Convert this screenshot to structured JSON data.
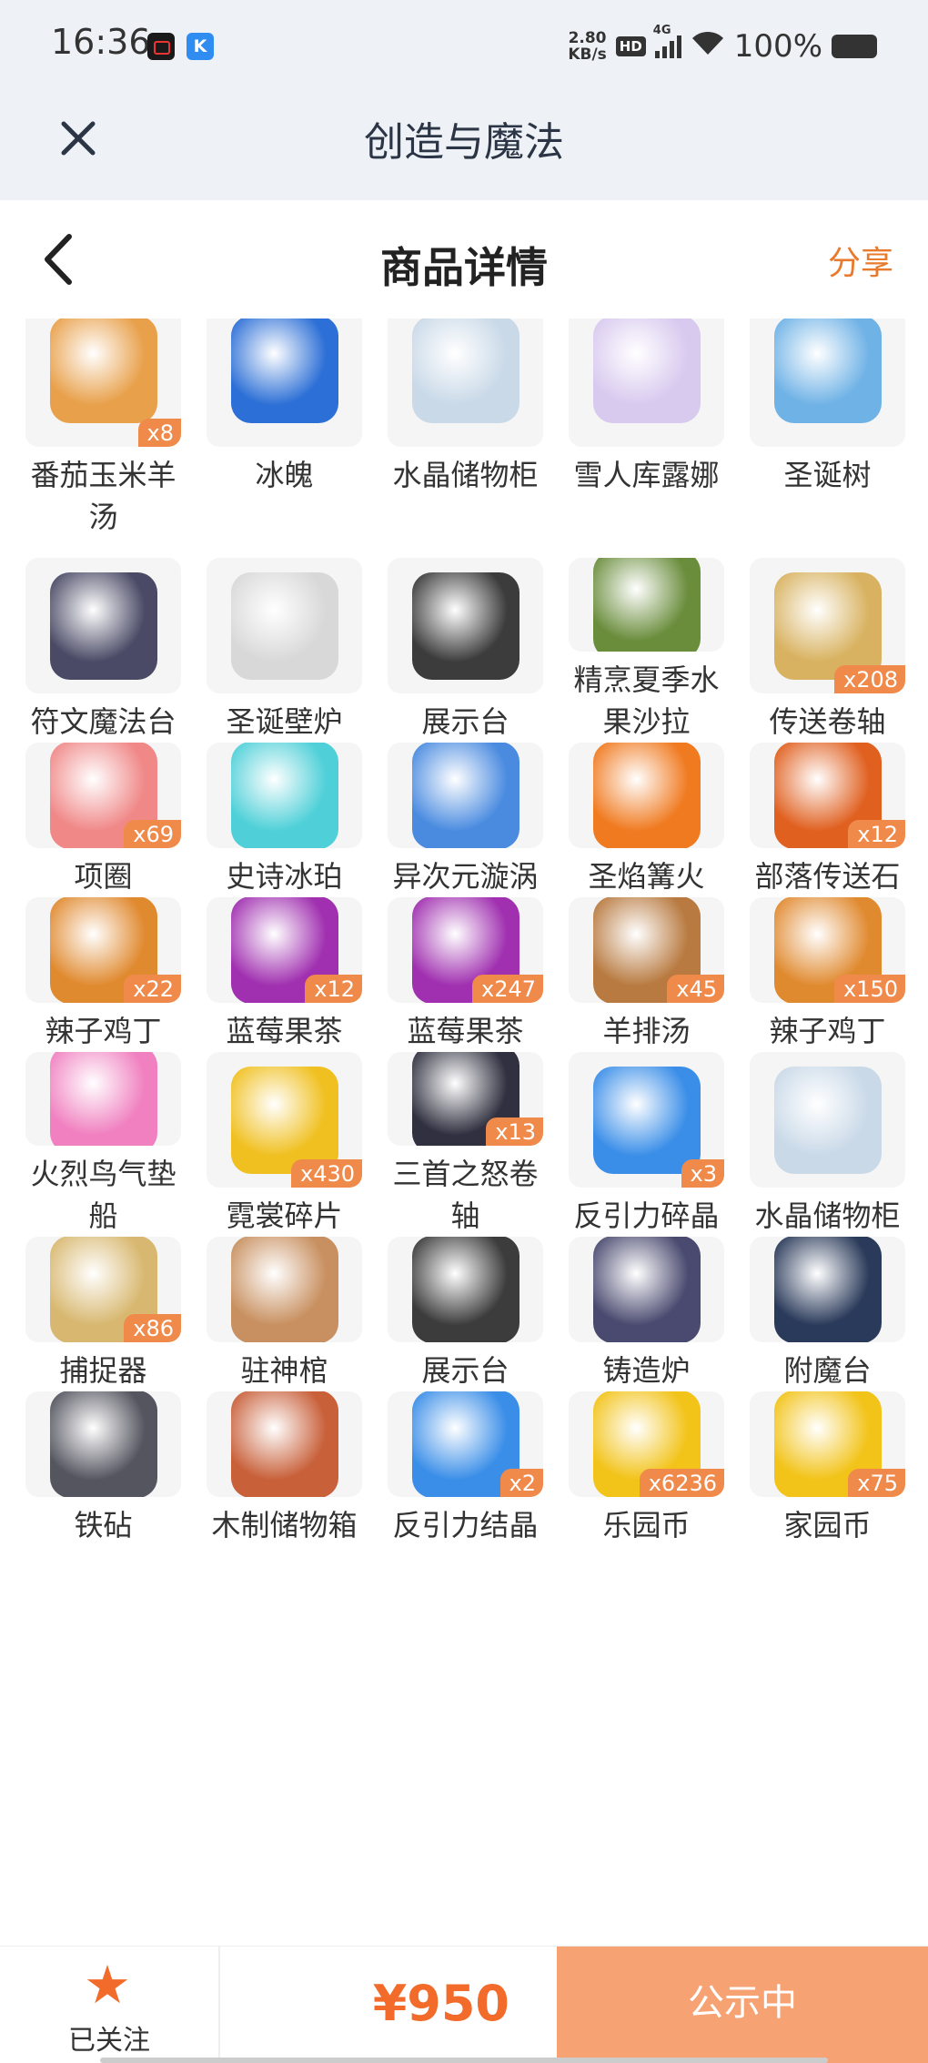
{
  "status_bar": {
    "time": "16:36",
    "net_speed_value": "2.80",
    "net_speed_unit": "KB/s",
    "hd": "HD",
    "network": "4G",
    "battery": "100%",
    "icons": [
      "screen-record-icon",
      "k-app-icon",
      "wifi-icon",
      "battery-icon"
    ]
  },
  "title_bar": {
    "title": "创造与魔法",
    "close_icon": "close-icon"
  },
  "nav": {
    "title": "商品详情",
    "share": "分享",
    "back_icon": "back-arrow-icon"
  },
  "items": [
    {
      "name": "番茄玉米羊汤",
      "qty": "x8",
      "color": "#e8a04a"
    },
    {
      "name": "冰魄",
      "qty": "",
      "color": "#2c6fd6"
    },
    {
      "name": "水晶储物柜",
      "qty": "",
      "color": "#c9d9e8"
    },
    {
      "name": "雪人库露娜",
      "qty": "",
      "color": "#d8c9ef"
    },
    {
      "name": "圣诞树",
      "qty": "",
      "color": "#6fb2e6"
    },
    {
      "name": "符文魔法台",
      "qty": "",
      "color": "#4a4a66"
    },
    {
      "name": "圣诞壁炉",
      "qty": "",
      "color": "#d8d8d8"
    },
    {
      "name": "展示台",
      "qty": "",
      "color": "#3c3c3c"
    },
    {
      "name": "精烹夏季水果沙拉",
      "qty": "",
      "color": "#6a8d3c"
    },
    {
      "name": "传送卷轴",
      "qty": "x208",
      "color": "#d8b260"
    },
    {
      "name": "项圈",
      "qty": "x69",
      "color": "#f08888"
    },
    {
      "name": "史诗冰珀",
      "qty": "",
      "color": "#4fd0d8"
    },
    {
      "name": "异次元漩涡",
      "qty": "",
      "color": "#4a8be0"
    },
    {
      "name": "圣焰篝火",
      "qty": "",
      "color": "#f07a20"
    },
    {
      "name": "部落传送石",
      "qty": "x12",
      "color": "#e06020"
    },
    {
      "name": "辣子鸡丁",
      "qty": "x22",
      "color": "#e08a30"
    },
    {
      "name": "蓝莓果茶",
      "qty": "x12",
      "color": "#a030b0"
    },
    {
      "name": "蓝莓果茶",
      "qty": "x247",
      "color": "#a030b0"
    },
    {
      "name": "羊排汤",
      "qty": "x45",
      "color": "#b87a40"
    },
    {
      "name": "辣子鸡丁",
      "qty": "x150",
      "color": "#e08a30"
    },
    {
      "name": "火烈鸟气垫船",
      "qty": "",
      "color": "#f080c0"
    },
    {
      "name": "霓裳碎片",
      "qty": "x430",
      "color": "#f0c020"
    },
    {
      "name": "三首之怒卷轴",
      "qty": "x13",
      "color": "#303040"
    },
    {
      "name": "反引力碎晶",
      "qty": "x3",
      "color": "#3a8ee8"
    },
    {
      "name": "水晶储物柜",
      "qty": "",
      "color": "#c9d9e8"
    },
    {
      "name": "捕捉器",
      "qty": "x86",
      "color": "#d8b870"
    },
    {
      "name": "驻神棺",
      "qty": "",
      "color": "#c89060"
    },
    {
      "name": "展示台",
      "qty": "",
      "color": "#3c3c3c"
    },
    {
      "name": "铸造炉",
      "qty": "",
      "color": "#4a4a70"
    },
    {
      "name": "附魔台",
      "qty": "",
      "color": "#2a3a5a"
    },
    {
      "name": "铁砧",
      "qty": "",
      "color": "#555560"
    },
    {
      "name": "木制储物箱",
      "qty": "",
      "color": "#c8603a"
    },
    {
      "name": "反引力结晶",
      "qty": "x2",
      "color": "#3a8ee8"
    },
    {
      "name": "乐园币",
      "qty": "x6236",
      "color": "#f2c318"
    },
    {
      "name": "家园币",
      "qty": "x75",
      "color": "#f2c318"
    }
  ],
  "bottom_bar": {
    "follow_label": "已关注",
    "price": "¥950",
    "status_button": "公示中",
    "accent": "#f26b2a"
  }
}
